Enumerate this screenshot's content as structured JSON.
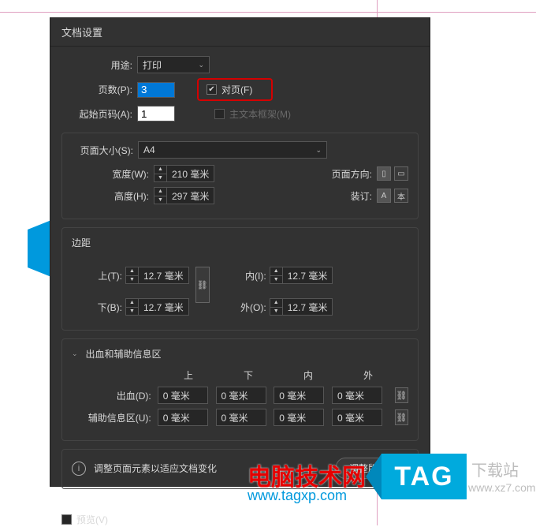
{
  "dialog": {
    "title": "文档设置",
    "intent": {
      "label": "用途:",
      "value": "打印"
    },
    "pages": {
      "label": "页数(P):",
      "value": "3"
    },
    "facing": {
      "label": "对页(F)",
      "checked": true
    },
    "startPage": {
      "label": "起始页码(A):",
      "value": "1"
    },
    "masterFrame": {
      "label": "主文本框架(M)",
      "checked": false
    },
    "pageSize": {
      "label": "页面大小(S):",
      "value": "A4",
      "width": {
        "label": "宽度(W):",
        "value": "210 毫米"
      },
      "height": {
        "label": "高度(H):",
        "value": "297 毫米"
      },
      "orientation": {
        "label": "页面方向:"
      },
      "binding": {
        "label": "装订:"
      }
    },
    "margins": {
      "title": "边距",
      "top": {
        "label": "上(T):",
        "value": "12.7 毫米"
      },
      "bottom": {
        "label": "下(B):",
        "value": "12.7 毫米"
      },
      "inside": {
        "label": "内(I):",
        "value": "12.7 毫米"
      },
      "outside": {
        "label": "外(O):",
        "value": "12.7 毫米"
      }
    },
    "bleed": {
      "title": "出血和辅助信息区",
      "cols": {
        "top": "上",
        "bottom": "下",
        "inside": "内",
        "outside": "外"
      },
      "bleedRow": {
        "label": "出血(D):",
        "top": "0 毫米",
        "bottom": "0 毫米",
        "inside": "0 毫米",
        "outside": "0 毫米"
      },
      "slugRow": {
        "label": "辅助信息区(U):",
        "top": "0 毫米",
        "bottom": "0 毫米",
        "inside": "0 毫米",
        "outside": "0 毫米"
      }
    },
    "adjust": {
      "info": "调整页面元素以适应文档变化",
      "button": "调整版面..."
    },
    "preview": {
      "label": "预览(V)",
      "checked": false
    }
  },
  "watermark": {
    "line1": "电脑技术网",
    "line2": "www.tagxp.com",
    "tag": "TAG",
    "right1": "下载站",
    "right2": "www.xz7.com"
  }
}
